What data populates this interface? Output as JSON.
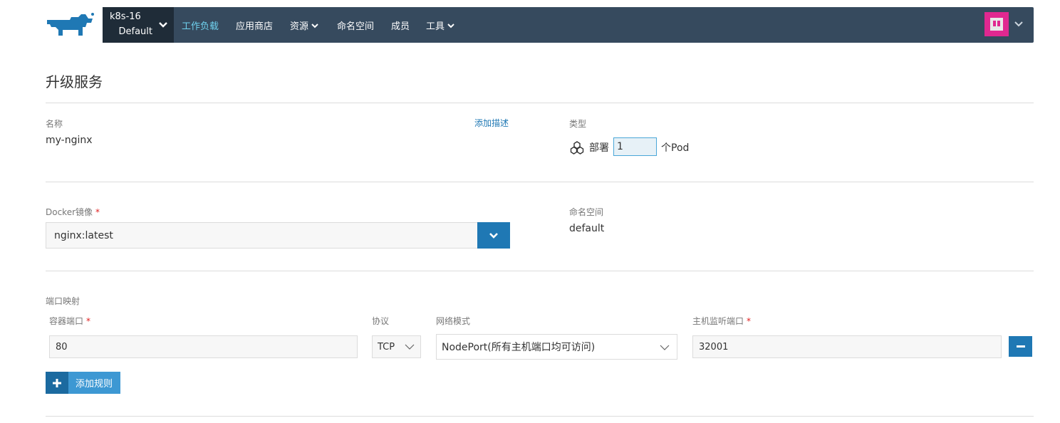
{
  "nav": {
    "cluster": "k8s-16",
    "project": "Default",
    "items": [
      {
        "label": "工作负载",
        "active": true,
        "dropdown": false
      },
      {
        "label": "应用商店",
        "active": false,
        "dropdown": false
      },
      {
        "label": "资源",
        "active": false,
        "dropdown": true
      },
      {
        "label": "命名空间",
        "active": false,
        "dropdown": false
      },
      {
        "label": "成员",
        "active": false,
        "dropdown": false
      },
      {
        "label": "工具",
        "active": false,
        "dropdown": true
      }
    ]
  },
  "page": {
    "title": "升级服务"
  },
  "name_section": {
    "label": "名称",
    "value": "my-nginx",
    "add_description": "添加描述"
  },
  "type_section": {
    "label": "类型",
    "deploy_label": "部署",
    "scale": "1",
    "suffix": "个Pod"
  },
  "image_section": {
    "label": "Docker镜像",
    "required": "*",
    "value": "nginx:latest"
  },
  "namespace_section": {
    "label": "命名空间",
    "value": "default"
  },
  "ports": {
    "label": "端口映射",
    "col_container_port": "容器端口",
    "col_protocol": "协议",
    "col_network_mode": "网络模式",
    "col_host_port": "主机监听端口",
    "required": "*",
    "row": {
      "container_port": "80",
      "protocol": "TCP",
      "network_mode": "NodePort(所有主机端口均可访问)",
      "host_port": "32001"
    },
    "add_rule": "添加规则"
  },
  "colors": {
    "nav_bg": "#364a5e",
    "cluster_bg": "#1f2c38",
    "nav_active": "#6fd1ee",
    "primary": "#1f78b4",
    "primary_light": "#3d98d3",
    "link": "#1f78b4",
    "required": "#e02020"
  },
  "icons": {
    "logo": "rancher-logo",
    "deploy": "deployment-icon",
    "avatar": "user-avatar",
    "chevron": "chevron-down-icon",
    "minus": "minus-icon",
    "plus": "plus-icon"
  }
}
